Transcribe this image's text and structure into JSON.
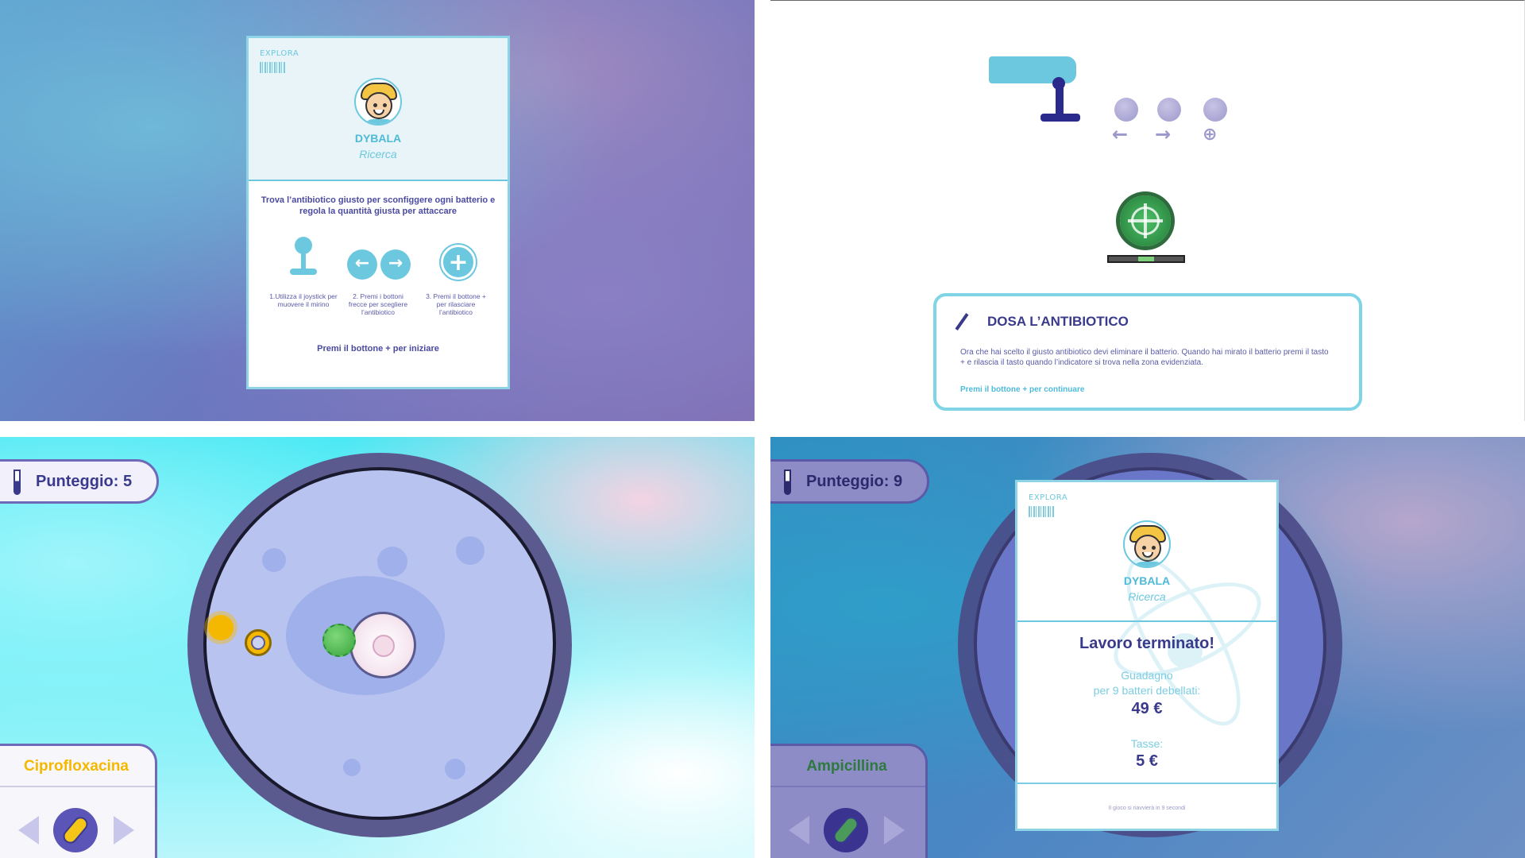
{
  "colors": {
    "accent": "#6cc8df",
    "primary": "#3a3a8c",
    "button_gray": "#9d98cc",
    "cipro_yellow": "#f5b800",
    "ampi_green": "#4a9a5a"
  },
  "intro_card": {
    "brand": "EXPLORA",
    "character_name": "DYBALA",
    "character_role": "Ricerca",
    "instruction": "Trova l’antibiotico giusto per sconfiggere ogni batterio e regola la quantità giusta per attaccare",
    "steps": [
      {
        "icon": "joystick-icon",
        "caption": "1.Utilizza il joystick per muovere il mirino"
      },
      {
        "icon": "arrow-buttons-icon",
        "caption": "2. Premi i bottoni frecce per scegliere l’antibiotico"
      },
      {
        "icon": "plus-button-icon",
        "caption": "3. Premi il bottone + per rilasciare l’antibiotico"
      }
    ],
    "start_prompt": "Premi il bottone + per iniziare",
    "arrow_left": "←",
    "arrow_right": "→",
    "plus": "+"
  },
  "dose_tutorial": {
    "controls": {
      "arrow_left": "←",
      "arrow_right": "→",
      "plus": "⊕"
    },
    "title": "DOSA L’ANTIBIOTICO",
    "text": "Ora che hai scelto il giusto antibiotico devi eliminare il batterio. Quando hai mirato il batterio premi il tasto + e rilascia il tasto quando l’indicatore si trova nella zona evidenziata.",
    "continue_prompt": "Premi il bottone + per continuare",
    "dose_indicator_level": 0.5
  },
  "game_view": {
    "score_label": "Punteggio: 5",
    "drug_name": "Ciprofloxacina"
  },
  "result_view": {
    "score_label": "Punteggio: 9",
    "drug_name": "Ampicillina",
    "card": {
      "brand": "EXPLORA",
      "character_name": "DYBALA",
      "character_role": "Ricerca",
      "title": "Lavoro terminato!",
      "earnings_label": "Guadagno",
      "earnings_detail": "per 9 batteri debellati:",
      "earnings_value": "49 €",
      "tax_label": "Tasse:",
      "tax_value": "5 €",
      "restart_note": "Il gioco si riavvierà in 9 secondi"
    }
  }
}
